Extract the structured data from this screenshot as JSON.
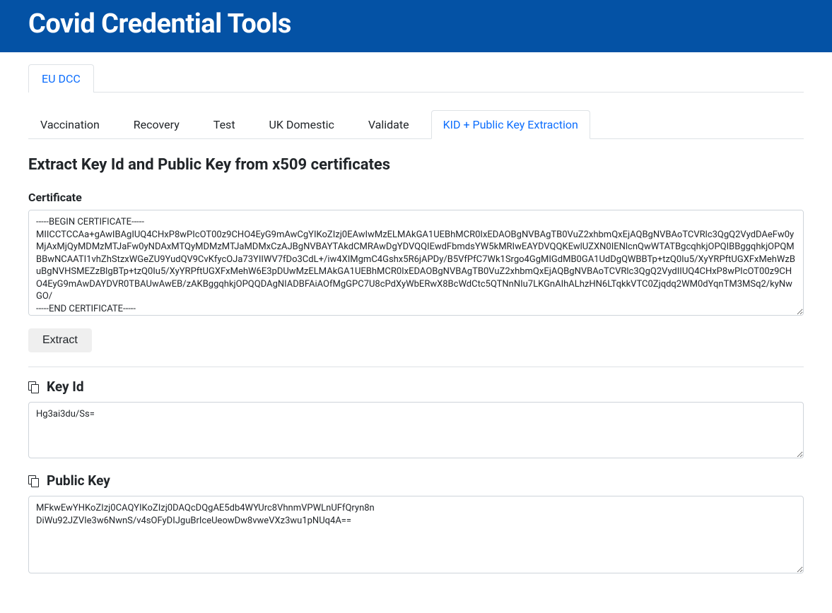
{
  "header": {
    "title": "Covid Credential Tools"
  },
  "top_tabs": {
    "active": "EU DCC"
  },
  "sub_tabs": {
    "items": [
      "Vaccination",
      "Recovery",
      "Test",
      "UK Domestic",
      "Validate",
      "KID + Public Key Extraction"
    ],
    "active_index": 5
  },
  "page": {
    "heading": "Extract Key Id and Public Key from x509 certificates",
    "cert_label": "Certificate",
    "cert_value": "-----BEGIN CERTIFICATE-----\nMIICCTCCAa+gAwIBAgIUQ4CHxP8wPIcOT00z9CHO4EyG9mAwCgYIKoZIzj0EAwIwMzELMAkGA1UEBhMCR0IxEDAOBgNVBAgTB0VuZ2xhbmQxEjAQBgNVBAoTCVRlc3QgQ2VydDAeFw0yMjAxMjQyMDMzMTJaFw0yNDAxMTQyMDMzMTJaMDMxCzAJBgNVBAYTAkdCMRAwDgYDVQQIEwdFbmdsYW5kMRIwEAYDVQQKEwlUZXN0IENlcnQwWTATBgcqhkjOPQIBBggqhkjOPQMBBwNCAATI1vhZhStzxWGeZU9YudQV9CvKfycOJa73YIIWV7fDo3CdL+/iw4XIMgmC4Gshx5R6jAPDy/B5VfPfC7Wk1Srgo4GgMIGdMB0GA1UdDgQWBBTp+tzQ0Iu5/XyYRPftUGXFxMehWzBuBgNVHSMEZzBlgBTp+tzQ0Iu5/XyYRPftUGXFxMehW6E3pDUwMzELMAkGA1UEBhMCR0IxEDAOBgNVBAgTB0VuZ2xhbmQxEjAQBgNVBAoTCVRlc3QgQ2VydIIUQ4CHxP8wPIcOT00z9CHO4EyG9mAwDAYDVR0TBAUwAwEB/zAKBggqhkjOPQQDAgNIADBFAiAOfMgGPC7U8cPdXyWbERwX8BcWdCtc5QTNnNIu7LKGnAIhALhzHN6LTqkkVTC0Zjqdq2WM0dYqnTM3MSq2/kyNwGO/\n-----END CERTIFICATE-----",
    "extract_button": "Extract",
    "keyid_label": "Key Id",
    "keyid_value": "Hg3ai3du/Ss=",
    "pubkey_label": "Public Key",
    "pubkey_value": "MFkwEwYHKoZIzj0CAQYIKoZIzj0DAQcDQgAE5db4WYUrc8VhnmVPWLnUFfQryn8n\nDiWu92JZVIe3w6NwnS/v4sOFyDIJguBrIceUeowDw8vweVXz3wu1pNUq4A=="
  }
}
